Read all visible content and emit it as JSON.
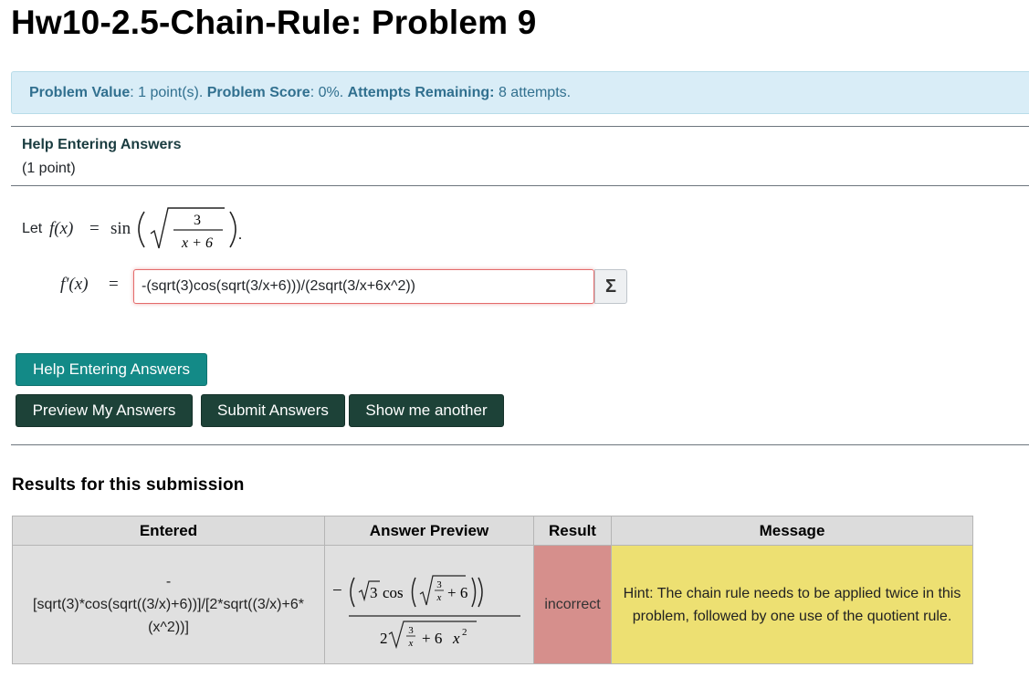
{
  "page": {
    "title": "Hw10-2.5-Chain-Rule: Problem 9"
  },
  "problem_info": {
    "value_label": "Problem Value",
    "value_text": ": 1 point(s). ",
    "score_label": "Problem Score",
    "score_text": ": 0%. ",
    "attempts_label": "Attempts Remaining:",
    "attempts_text": " 8 attempts."
  },
  "problem": {
    "help_heading": "Help Entering Answers",
    "points": "(1 point)",
    "let_text": "Let",
    "function_lhs": "f(x)",
    "function_equals": "=",
    "function_sin": "sin",
    "derivative_lhs": "f′(x)",
    "derivative_equals": "=",
    "fraction_numerator": "3",
    "fraction_denominator": "x + 6",
    "period": "."
  },
  "answer": {
    "value": "-(sqrt(3)cos(sqrt(3/x+6)))/(2sqrt(3/x+6x^2))",
    "equation_editor_icon": "sigma-icon",
    "equation_editor_glyph": "Σ"
  },
  "buttons": {
    "help": "Help Entering Answers",
    "preview": "Preview My Answers",
    "submit": "Submit Answers",
    "another": "Show me another"
  },
  "results": {
    "heading": "Results for this submission",
    "columns": [
      "Entered",
      "Answer Preview",
      "Result",
      "Message"
    ],
    "row": {
      "entered_line1": "-",
      "entered_line2": "[sqrt(3)*cos(sqrt((3/x)+6))]/[2*sqrt((3/x)+6*",
      "entered_line3": "(x^2))]",
      "preview_minus": "−",
      "preview_three": "3",
      "preview_cos": "cos",
      "preview_plus6": "+ 6",
      "preview_frac_num": "3",
      "preview_frac_den": "x",
      "preview_two": "2",
      "preview_plus6x": "+ 6",
      "preview_x": "x",
      "preview_exp": "2",
      "result": "incorrect",
      "message": "Hint: The chain rule needs to be applied twice in this problem, followed by one use of the quotient rule."
    }
  },
  "colors": {
    "info_background": "#d9edf7",
    "info_text": "#31708f",
    "help_button": "#138a87",
    "dark_button": "#1d4238",
    "incorrect_cell": "#d68f8c",
    "message_cell": "#ede072",
    "input_error_border": "#e46b6b"
  }
}
